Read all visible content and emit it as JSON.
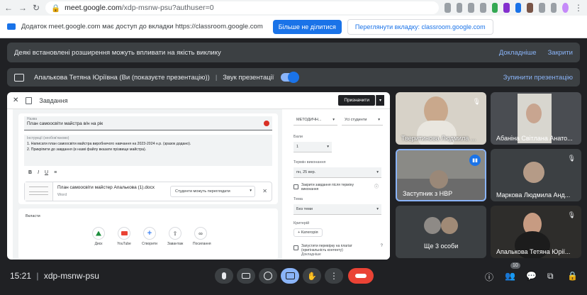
{
  "browser": {
    "url_host": "meet.google.com",
    "url_path": "/xdp-msnw-psu?authuser=0"
  },
  "share_bar": {
    "message": "Додаток meet.google.com має доступ до вкладки https://classroom.google.com",
    "stop_label": "Більше не ділитися",
    "switch_label": "Переглянути вкладку: classroom.google.com"
  },
  "ext_banner": {
    "message": "Деякі встановлені розширення можуть впливати на якість виклику",
    "more_label": "Докладніше",
    "close_label": "Закрити"
  },
  "present_banner": {
    "presenter": "Апалькова Тетяна Юріївна (Ви (показуєте презентацію))",
    "audio_label": "Звук презентації",
    "stop_label": "Зупинити презентацію"
  },
  "doc": {
    "title": "Завдання",
    "assign_label": "Призначити",
    "name_caption": "Назва",
    "name_value": "План самоосвіти майстра в/н на рік",
    "instr_caption": "Інструкції (необов'язково)",
    "instr_line1": "1. Написати план самоосвіти майстра виробничого навчання на 2023-2024 н.р. (зразок додано).",
    "instr_line2": "2. Прикріпити до завдання (в назві файлу вказати прізвище майстра).",
    "format": [
      "B",
      "I",
      "U",
      "≡"
    ],
    "attachment_name": "План самоосвіти майстер Апалькова (1).docx",
    "attachment_type": "Word",
    "attachment_perm": "Студенти можуть переглядати",
    "insert_caption": "Вкласти",
    "insert_items": [
      {
        "label": "Диск",
        "icon": "drive-icon",
        "color": "#1e8e3e"
      },
      {
        "label": "YouTube",
        "icon": "youtube-icon",
        "color": "#ea4335"
      },
      {
        "label": "Створити",
        "icon": "plus-icon",
        "color": "#4285f4"
      },
      {
        "label": "Завантаж",
        "icon": "upload-icon",
        "color": "#3c4043"
      },
      {
        "label": "Посилання",
        "icon": "link-icon",
        "color": "#3c4043"
      }
    ],
    "right": {
      "class_value": "МЕТОДИЧН...",
      "students_value": "Усі студенти",
      "points_caption": "Бали",
      "points_value": "1",
      "due_caption": "Термін виконання",
      "due_value": "пн, 25 вер.",
      "close_label": "Закрити завдання після терміну виконання",
      "topic_caption": "Тема",
      "topic_value": "Без теми",
      "rubric_caption": "Критерій",
      "rubric_btn": "Категорія",
      "plagiarism_label": "Запустити перевірку на плагіат (оригінальність контенту)",
      "plagiarism_more": "Докладніше"
    }
  },
  "participants": [
    {
      "name": "Тверитинова Людмила ..."
    },
    {
      "name": "Абаніна Світлана Анато..."
    },
    {
      "name": "Заступник з НВР"
    },
    {
      "name": "Маркова Людмила Анд..."
    },
    {
      "name": "Ще 3 особи"
    },
    {
      "name": "Апалькова Тетяна Юрії..."
    }
  ],
  "meeting": {
    "time": "15:21",
    "code": "xdp-msnw-psu",
    "people_count": "10"
  }
}
